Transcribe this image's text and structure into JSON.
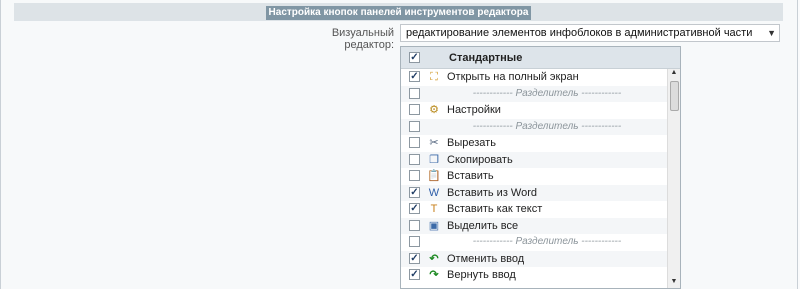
{
  "header": {
    "title": "Настройка кнопок панелей инструментов редактора"
  },
  "editor": {
    "label": "Визуальный редактор:",
    "selected": "редактирование элементов инфоблоков в административной части"
  },
  "toolbar_group": {
    "label": "Стандартные",
    "checked": true
  },
  "items": [
    {
      "label": "Открыть на полный экран",
      "checked": true,
      "icon": "fullscreen-icon",
      "glyph": "⛶"
    },
    {
      "separator": "------------ Разделитель ------------",
      "checked": false
    },
    {
      "label": "Настройки",
      "checked": false,
      "icon": "gear-icon",
      "glyph": "⚙"
    },
    {
      "separator": "------------ Разделитель ------------",
      "checked": false
    },
    {
      "label": "Вырезать",
      "checked": false,
      "icon": "scissors-icon",
      "glyph": "✂"
    },
    {
      "label": "Скопировать",
      "checked": false,
      "icon": "copy-icon",
      "glyph": "❐"
    },
    {
      "label": "Вставить",
      "checked": false,
      "icon": "paste-icon",
      "glyph": "📋"
    },
    {
      "label": "Вставить из Word",
      "checked": true,
      "icon": "paste-word-icon",
      "glyph": "W"
    },
    {
      "label": "Вставить как текст",
      "checked": true,
      "icon": "paste-text-icon",
      "glyph": "T"
    },
    {
      "label": "Выделить все",
      "checked": false,
      "icon": "select-all-icon",
      "glyph": "▣"
    },
    {
      "separator": "------------ Разделитель ------------",
      "checked": false
    },
    {
      "label": "Отменить ввод",
      "checked": true,
      "icon": "undo-icon",
      "glyph": "↶"
    },
    {
      "label": "Вернуть ввод",
      "checked": true,
      "icon": "redo-icon",
      "glyph": "↷"
    }
  ],
  "colors": {
    "header_bg": "#8096a4",
    "check": "#213e66",
    "separator_text": "#8c959b"
  }
}
